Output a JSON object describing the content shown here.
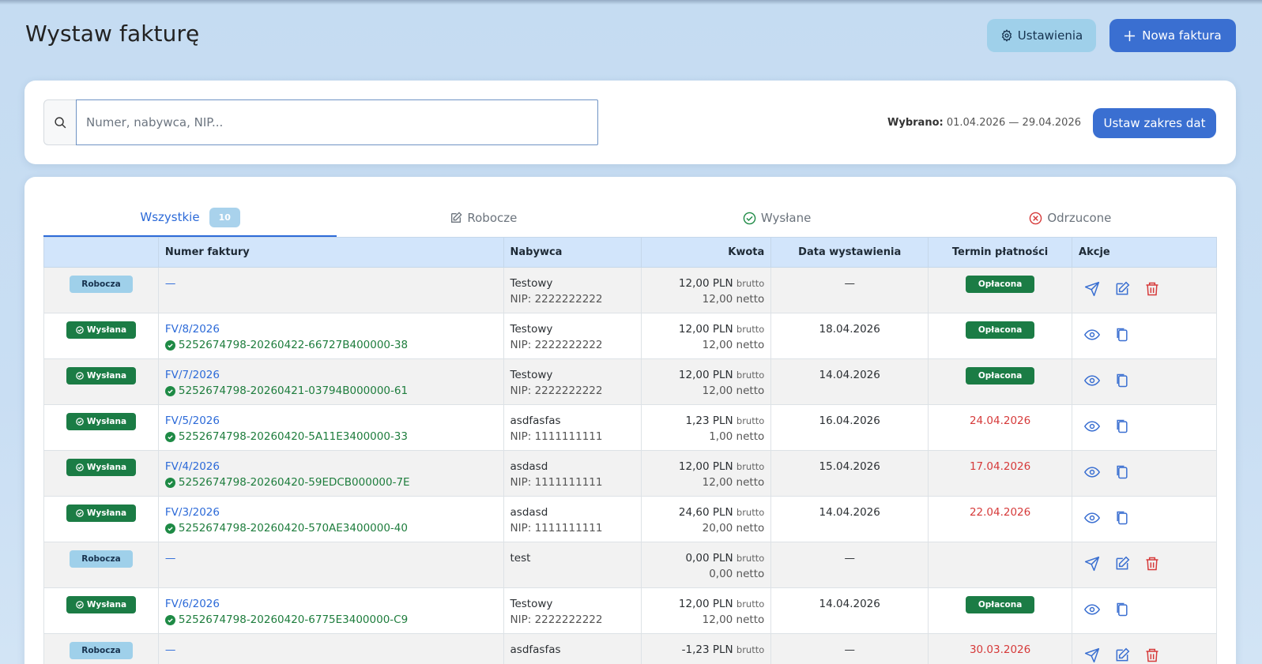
{
  "header": {
    "title": "Wystaw fakturę",
    "settings_label": "Ustawienia",
    "new_label": "Nowa faktura"
  },
  "search": {
    "placeholder": "Numer, nabywca, NIP...",
    "value": "",
    "range_label": "Wybrano:",
    "range_value": "01.04.2026 — 29.04.2026",
    "range_button": "Ustaw zakres dat"
  },
  "tabs": [
    {
      "label": "Wszystkie",
      "count": "10"
    },
    {
      "label": "Robocze"
    },
    {
      "label": "Wysłane"
    },
    {
      "label": "Odrzucone"
    }
  ],
  "columns": {
    "status": "",
    "number": "Numer faktury",
    "buyer": "Nabywca",
    "amount": "Kwota",
    "issue_date": "Data wystawienia",
    "due": "Termin płatności",
    "actions": "Akcje"
  },
  "labels": {
    "draft": "Robocza",
    "sent": "Wysłana",
    "paid": "Opłacona",
    "brutto": "brutto",
    "netto": "netto",
    "nip_prefix": "NIP: "
  },
  "rows": [
    {
      "status": "draft",
      "number": "—",
      "ksef": "",
      "buyer": "Testowy",
      "nip": "NIP: 2222222222",
      "gross": "12,00 PLN",
      "net": "12,00 netto",
      "date": "—",
      "due": "Opłacona",
      "due_type": "paid"
    },
    {
      "status": "sent",
      "number": "FV/8/2026",
      "ksef": "5252674798-20260422-66727B400000-38",
      "buyer": "Testowy",
      "nip": "NIP: 2222222222",
      "gross": "12,00 PLN",
      "net": "12,00 netto",
      "date": "18.04.2026",
      "due": "Opłacona",
      "due_type": "paid"
    },
    {
      "status": "sent",
      "number": "FV/7/2026",
      "ksef": "5252674798-20260421-03794B000000-61",
      "buyer": "Testowy",
      "nip": "NIP: 2222222222",
      "gross": "12,00 PLN",
      "net": "12,00 netto",
      "date": "14.04.2026",
      "due": "Opłacona",
      "due_type": "paid"
    },
    {
      "status": "sent",
      "number": "FV/5/2026",
      "ksef": "5252674798-20260420-5A11E3400000-33",
      "buyer": "asdfasfas",
      "nip": "NIP: 1111111111",
      "gross": "1,23 PLN",
      "net": "1,00 netto",
      "date": "16.04.2026",
      "due": "24.04.2026",
      "due_type": "overdue"
    },
    {
      "status": "sent",
      "number": "FV/4/2026",
      "ksef": "5252674798-20260420-59EDCB000000-7E",
      "buyer": "asdasd",
      "nip": "NIP: 1111111111",
      "gross": "12,00 PLN",
      "net": "12,00 netto",
      "date": "15.04.2026",
      "due": "17.04.2026",
      "due_type": "overdue"
    },
    {
      "status": "sent",
      "number": "FV/3/2026",
      "ksef": "5252674798-20260420-570AE3400000-40",
      "buyer": "asdasd",
      "nip": "NIP: 1111111111",
      "gross": "24,60 PLN",
      "net": "20,00 netto",
      "date": "14.04.2026",
      "due": "22.04.2026",
      "due_type": "overdue"
    },
    {
      "status": "draft",
      "number": "—",
      "ksef": "",
      "buyer": "test",
      "nip": "",
      "gross": "0,00 PLN",
      "net": "0,00 netto",
      "date": "—",
      "due": "",
      "due_type": "none"
    },
    {
      "status": "sent",
      "number": "FV/6/2026",
      "ksef": "5252674798-20260420-6775E3400000-C9",
      "buyer": "Testowy",
      "nip": "NIP: 2222222222",
      "gross": "12,00 PLN",
      "net": "12,00 netto",
      "date": "14.04.2026",
      "due": "Opłacona",
      "due_type": "paid"
    },
    {
      "status": "draft",
      "number": "—",
      "ksef": "",
      "buyer": "asdfasfas",
      "nip": "",
      "gross": "-1,23 PLN",
      "net": "",
      "date": "—",
      "due": "30.03.2026",
      "due_type": "overdue"
    }
  ],
  "colors": {
    "accent": "#3a6fd1",
    "success": "#1b7c45",
    "danger": "#d63a3a",
    "draft": "#9fd0ea"
  }
}
